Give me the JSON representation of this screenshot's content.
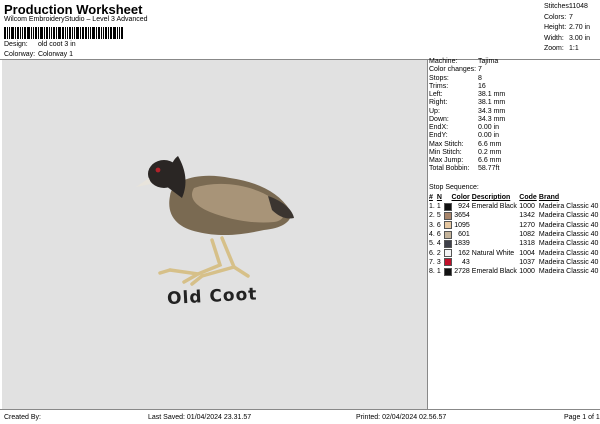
{
  "header": {
    "title": "Production Worksheet",
    "subtitle": "Wilcom EmbroideryStudio – Level 3 Advanced"
  },
  "design": {
    "design_label": "Design:",
    "design_value": "old coot 3 in",
    "colorway_label": "Colorway:",
    "colorway_value": "Colorway 1"
  },
  "stats": [
    {
      "label": "Stitches:",
      "value": "11048"
    },
    {
      "label": "Colors:",
      "value": "7"
    },
    {
      "label": "Height:",
      "value": "2.70 in"
    },
    {
      "label": "Width:",
      "value": "3.00 in"
    },
    {
      "label": "Zoom:",
      "value": "1:1"
    }
  ],
  "artwork": {
    "caption": "Old Coot",
    "colors": {
      "body_dark": "#3b3530",
      "body_mid": "#7a6a52",
      "body_light": "#a89478",
      "head": "#2a2624",
      "eye": "#b2222a",
      "bill": "#e8e4dc",
      "legs": "#d6c089"
    }
  },
  "info": [
    {
      "label": "Machine:",
      "value": "Tajima"
    },
    {
      "label": "Color changes:",
      "value": "7"
    },
    {
      "label": "Stops:",
      "value": "8"
    },
    {
      "label": "Trims:",
      "value": "16"
    },
    {
      "label": "Left:",
      "value": "38.1 mm"
    },
    {
      "label": "Right:",
      "value": "38.1 mm"
    },
    {
      "label": "Up:",
      "value": "34.3 mm"
    },
    {
      "label": "Down:",
      "value": "34.3 mm"
    },
    {
      "label": "EndX:",
      "value": "0.00 in"
    },
    {
      "label": "EndY:",
      "value": "0.00 in"
    },
    {
      "label": "Max Stitch:",
      "value": "6.6 mm"
    },
    {
      "label": "Min Stitch:",
      "value": "0.2 mm"
    },
    {
      "label": "Max Jump:",
      "value": "6.6 mm"
    },
    {
      "label": "Total Bobbin:",
      "value": "58.77ft"
    }
  ],
  "stop_sequence": {
    "title": "Stop Sequence:",
    "headers": {
      "num": "#",
      "n": "N",
      "color": "Color",
      "description": "Description",
      "code": "Code",
      "brand": "Brand"
    },
    "rows": [
      {
        "num": "1.",
        "n": "1",
        "swatch": "#111111",
        "color": "924",
        "description": "Emerald Black",
        "code": "1000",
        "brand": "Madeira Classic 40"
      },
      {
        "num": "2.",
        "n": "5",
        "swatch": "#a8856a",
        "color": "3654",
        "description": "",
        "code": "1342",
        "brand": "Madeira Classic 40"
      },
      {
        "num": "3.",
        "n": "6",
        "swatch": "#e6c7a0",
        "color": "1095",
        "description": "",
        "code": "1270",
        "brand": "Madeira Classic 40"
      },
      {
        "num": "4.",
        "n": "6",
        "swatch": "#c4b39a",
        "color": "601",
        "description": "",
        "code": "1082",
        "brand": "Madeira Classic 40"
      },
      {
        "num": "5.",
        "n": "4",
        "swatch": "#3e3f48",
        "color": "1839",
        "description": "",
        "code": "1318",
        "brand": "Madeira Classic 40"
      },
      {
        "num": "6.",
        "n": "2",
        "swatch": "#f4f4f4",
        "color": "162",
        "description": "Natural White",
        "code": "1004",
        "brand": "Madeira Classic 40"
      },
      {
        "num": "7.",
        "n": "3",
        "swatch": "#c0102a",
        "color": "43",
        "description": "",
        "code": "1037",
        "brand": "Madeira Classic 40"
      },
      {
        "num": "8.",
        "n": "1",
        "swatch": "#111111",
        "color": "2728",
        "description": "Emerald Black",
        "code": "1000",
        "brand": "Madeira Classic 40"
      }
    ]
  },
  "footer": {
    "created_by": "Created By:",
    "last_saved": "Last Saved: 01/04/2024 23.31.57",
    "printed": "Printed: 02/04/2024 02.56.57",
    "page": "Page 1 of 1"
  }
}
